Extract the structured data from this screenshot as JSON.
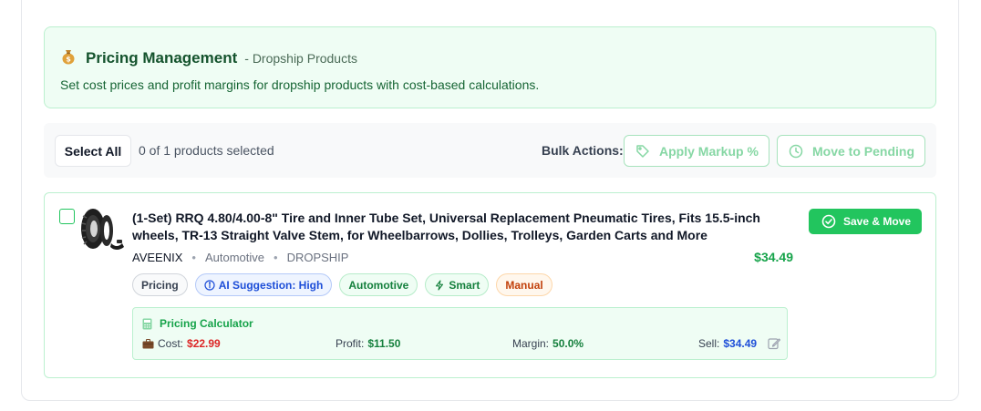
{
  "banner": {
    "icon": "money-bag-icon",
    "title": "Pricing Management",
    "subtitle": "- Dropship Products",
    "description": "Set cost prices and profit margins for dropship products with cost-based calculations."
  },
  "toolbar": {
    "select_all_label": "Select All",
    "selected_count": "0 of 1 products selected",
    "bulk_actions_label": "Bulk Actions:",
    "apply_markup_label": "Apply Markup %",
    "move_to_pending_label": "Move to Pending"
  },
  "product": {
    "title": "(1-Set) RRQ 4.80/4.00-8\" Tire and Inner Tube Set, Universal Replacement Pneumatic Tires, Fits 15.5-inch wheels, TR-13 Straight Valve Stem, for Wheelbarrows, Dollies, Trolleys, Garden Carts and More",
    "brand": "AVEENIX",
    "category": "Automotive",
    "type": "DROPSHIP",
    "price": "$34.49",
    "checked": false,
    "save_button_label": "Save & Move",
    "tags": {
      "pricing": "Pricing",
      "ai_suggestion": "AI Suggestion: High",
      "automotive": "Automotive",
      "smart": "Smart",
      "manual": "Manual"
    },
    "calculator": {
      "title": "Pricing Calculator",
      "cost_label": "Cost:",
      "cost_value": "$22.99",
      "profit_label": "Profit:",
      "profit_value": "$11.50",
      "margin_label": "Margin:",
      "margin_value": "50.0%",
      "sell_label": "Sell:",
      "sell_value": "$34.49"
    }
  },
  "colors": {
    "accent_green": "#22c55e",
    "banner_bg": "#effdf4",
    "price_green": "#16a34a",
    "cost_red": "#dc2626",
    "sell_blue": "#1d4ed8"
  }
}
